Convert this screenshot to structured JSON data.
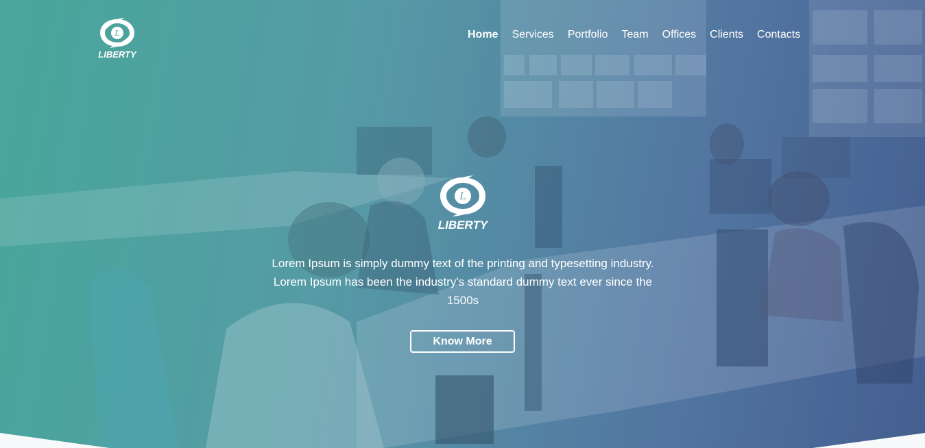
{
  "brand": {
    "name": "LIBERTY",
    "logo_letter": "L"
  },
  "nav": {
    "items": [
      {
        "label": "Home",
        "active": true
      },
      {
        "label": "Services",
        "active": false
      },
      {
        "label": "Portfolio",
        "active": false
      },
      {
        "label": "Team",
        "active": false
      },
      {
        "label": "Offices",
        "active": false
      },
      {
        "label": "Clients",
        "active": false
      },
      {
        "label": "Contacts",
        "active": false
      }
    ]
  },
  "hero": {
    "logo_text": "LIBERTY",
    "tagline_line1": "Lorem Ipsum is simply dummy text of the printing and typesetting industry.",
    "tagline_line2": "Lorem Ipsum has been the industry's standard dummy text ever since the",
    "tagline_line3": "1500s",
    "cta_label": "Know More"
  },
  "colors": {
    "overlay_left": "#4aa39a",
    "overlay_right": "#4d6a95",
    "text": "#ffffff",
    "bottom": "#ffffff"
  }
}
